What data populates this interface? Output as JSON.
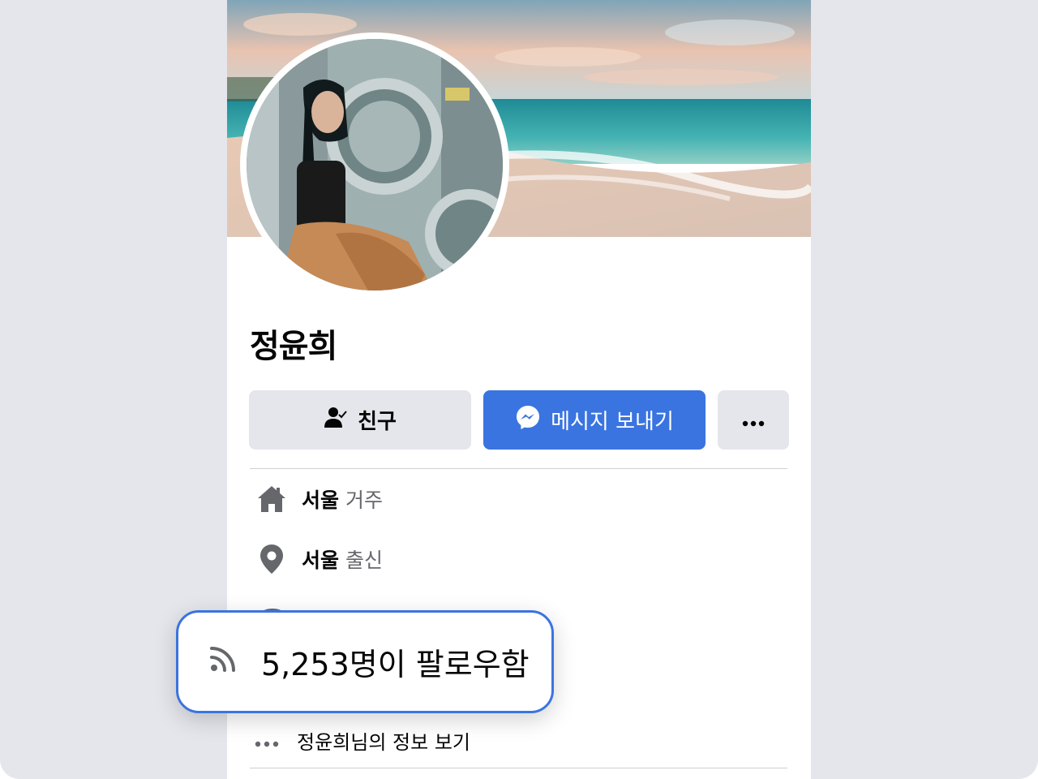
{
  "profile": {
    "name": "정윤희"
  },
  "actions": {
    "friend_label": "친구",
    "message_label": "메시지 보내기",
    "more_label": "•••"
  },
  "info": {
    "lives": {
      "place": "서울",
      "suffix": "거주",
      "icon": "home-icon"
    },
    "from": {
      "place": "서울",
      "suffix": "출신",
      "icon": "location-pin-icon"
    },
    "about_link": "정윤희님의 정보 보기"
  },
  "followers": {
    "text": "5,253명이 팔로우함",
    "icon": "rss-feed-icon"
  },
  "colors": {
    "accent": "#3a74e0",
    "button_gray": "#e4e6eb",
    "text_primary": "#050505",
    "text_secondary": "#65676b"
  }
}
